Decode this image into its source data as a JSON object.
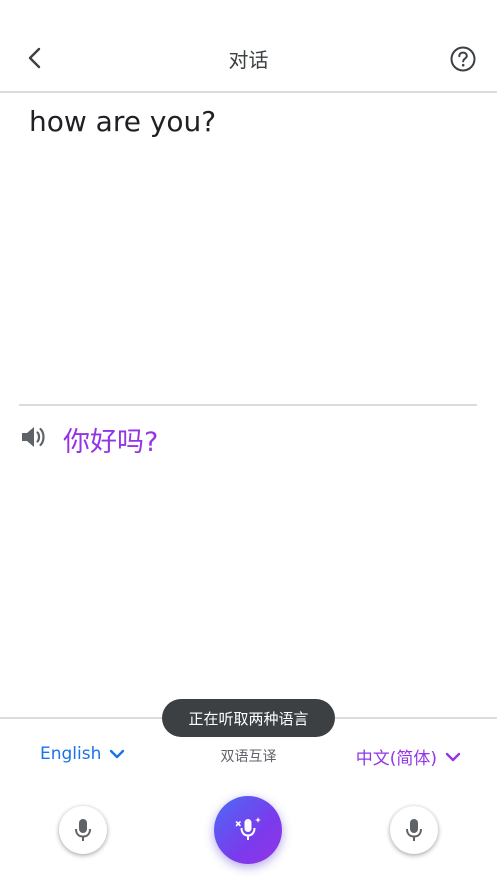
{
  "header": {
    "title": "对话",
    "back_icon": "chevron-left-icon",
    "help_icon": "help-circle-icon"
  },
  "source": {
    "text": "how are you?"
  },
  "translation": {
    "text": "你好吗?",
    "speaker_icon": "speaker-icon",
    "color": "#9334e6"
  },
  "toast": {
    "text": "正在听取两种语言"
  },
  "languages": {
    "left": "English",
    "left_color": "#1a73e8",
    "center": "双语互译",
    "right": "中文(简体)",
    "right_color": "#9334e6"
  },
  "mics": {
    "left_icon": "mic-icon",
    "center_icon": "mic-auto-icon",
    "right_icon": "mic-icon"
  }
}
